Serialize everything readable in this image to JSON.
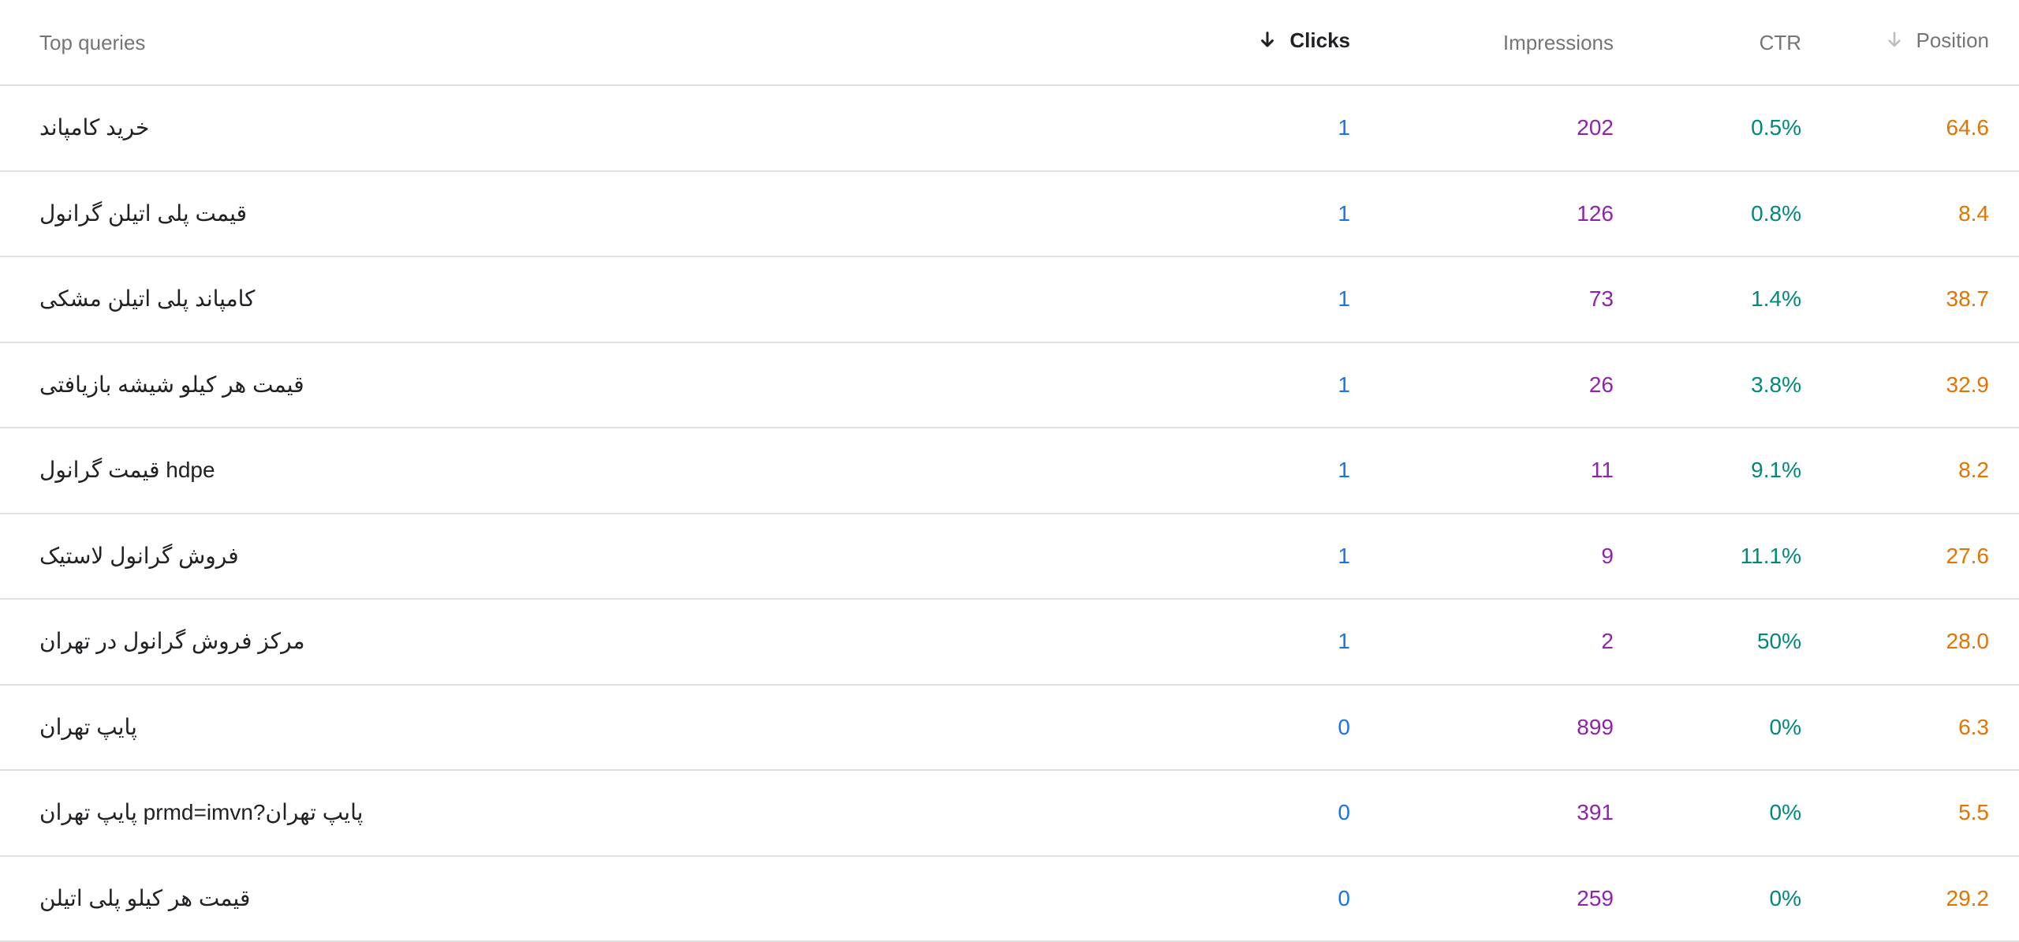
{
  "table": {
    "headers": {
      "query": "Top queries",
      "clicks": "Clicks",
      "impressions": "Impressions",
      "ctr": "CTR",
      "position": "Position"
    },
    "sort": {
      "column": "clicks",
      "direction": "desc"
    },
    "colors": {
      "clicks": "#1a73e8",
      "impressions": "#8e24aa",
      "ctr": "#00897b",
      "position": "#e37400",
      "header_active": "#202124",
      "header_inactive": "#757575",
      "row_divider": "#e0e0e0"
    },
    "rows": [
      {
        "query": "خرید کامپاند",
        "clicks": "1",
        "impressions": "202",
        "ctr": "0.5%",
        "position": "64.6"
      },
      {
        "query": "قیمت پلی اتیلن گرانول",
        "clicks": "1",
        "impressions": "126",
        "ctr": "0.8%",
        "position": "8.4"
      },
      {
        "query": "کامپاند پلی اتیلن مشکی",
        "clicks": "1",
        "impressions": "73",
        "ctr": "1.4%",
        "position": "38.7"
      },
      {
        "query": "قیمت هر کیلو شیشه بازیافتی",
        "clicks": "1",
        "impressions": "26",
        "ctr": "3.8%",
        "position": "32.9"
      },
      {
        "query": "قیمت گرانول hdpe",
        "clicks": "1",
        "impressions": "11",
        "ctr": "9.1%",
        "position": "8.2"
      },
      {
        "query": "فروش گرانول لاستیک",
        "clicks": "1",
        "impressions": "9",
        "ctr": "11.1%",
        "position": "27.6"
      },
      {
        "query": "مرکز فروش گرانول در تهران",
        "clicks": "1",
        "impressions": "2",
        "ctr": "50%",
        "position": "28.0"
      },
      {
        "query": "پایپ تهران",
        "clicks": "0",
        "impressions": "899",
        "ctr": "0%",
        "position": "6.3"
      },
      {
        "query": "پایپ تهران prmd=imvn?پایپ تهران",
        "clicks": "0",
        "impressions": "391",
        "ctr": "0%",
        "position": "5.5"
      },
      {
        "query": "قیمت هر کیلو پلی اتیلن",
        "clicks": "0",
        "impressions": "259",
        "ctr": "0%",
        "position": "29.2"
      }
    ]
  }
}
